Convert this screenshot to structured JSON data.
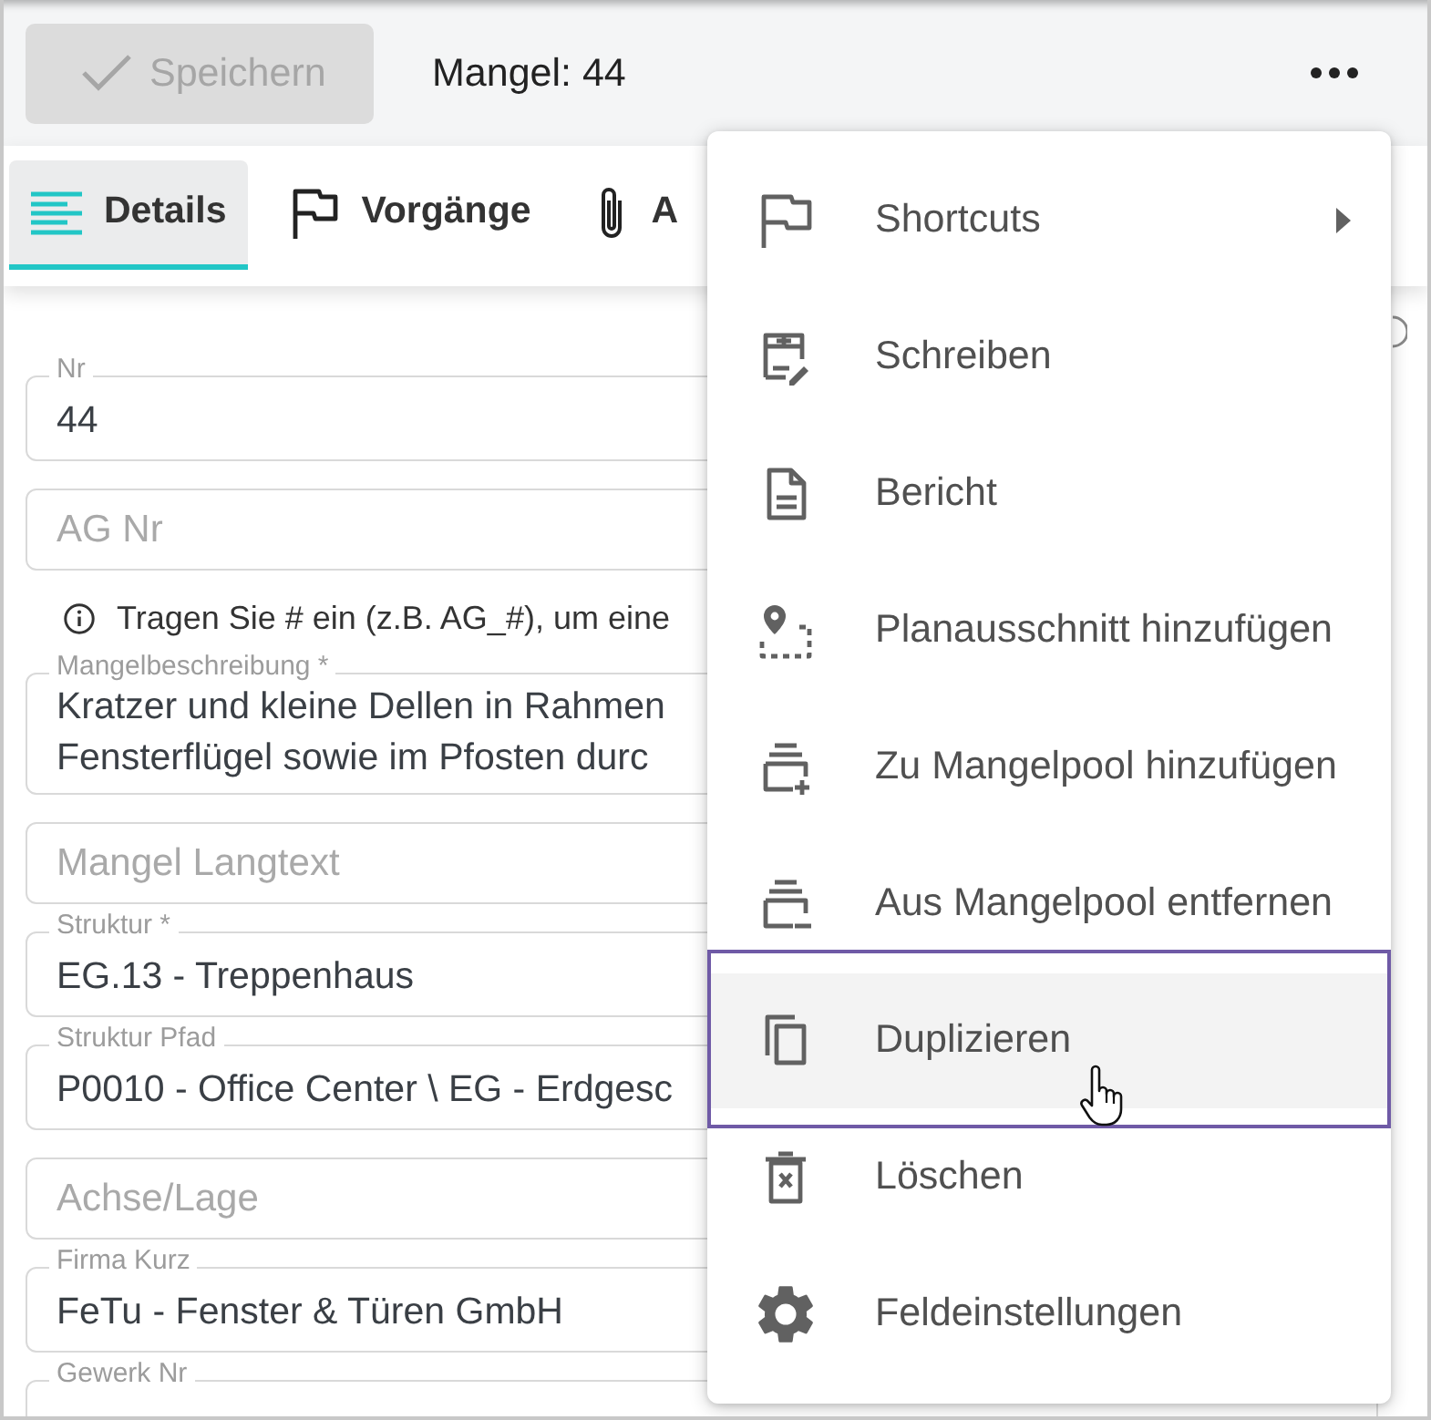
{
  "toolbar": {
    "save_button": {
      "label": "Speichern",
      "disabled": true
    },
    "title": "Mangel: 44"
  },
  "tabs": [
    {
      "label": "Details",
      "selected": true
    },
    {
      "label": "Vorgänge",
      "selected": false
    },
    {
      "label": "A",
      "selected": false
    }
  ],
  "form": {
    "fields": [
      {
        "kind": "field",
        "label": "Nr",
        "value": "44"
      },
      {
        "kind": "field",
        "placeholder": "AG Nr"
      },
      {
        "kind": "hint",
        "text": "Tragen Sie # ein (z.B. AG_#), um eine"
      },
      {
        "kind": "multiline",
        "label": "Mangelbeschreibung *",
        "lines": [
          "Kratzer und kleine Dellen in Rahmen",
          "Fensterflügel sowie im Pfosten durc"
        ]
      },
      {
        "kind": "field",
        "placeholder": "Mangel Langtext"
      },
      {
        "kind": "field",
        "label": "Struktur *",
        "value": "EG.13 - Treppenhaus"
      },
      {
        "kind": "field",
        "label": "Struktur Pfad",
        "value": "P0010 - Office Center \\ EG - Erdgesc"
      },
      {
        "kind": "field",
        "placeholder": "Achse/Lage"
      },
      {
        "kind": "field",
        "label": "Firma Kurz",
        "value": "FeTu - Fenster & Türen GmbH"
      },
      {
        "kind": "field",
        "label": "Gewerk Nr"
      }
    ]
  },
  "menu": {
    "items": [
      {
        "label": "Shortcuts",
        "submenu": true,
        "selected": false
      },
      {
        "label": "Schreiben",
        "submenu": false,
        "selected": false
      },
      {
        "label": "Bericht",
        "submenu": false,
        "selected": false
      },
      {
        "label": "Planausschnitt hinzufügen",
        "submenu": false,
        "selected": false
      },
      {
        "label": "Zu Mangelpool hinzufügen",
        "submenu": false,
        "selected": false
      },
      {
        "label": "Aus Mangelpool entfernen",
        "submenu": false,
        "selected": false
      },
      {
        "label": "Duplizieren",
        "submenu": false,
        "selected": true
      },
      {
        "label": "Löschen",
        "submenu": false,
        "selected": false
      },
      {
        "label": "Feldeinstellungen",
        "submenu": false,
        "selected": false
      }
    ]
  }
}
